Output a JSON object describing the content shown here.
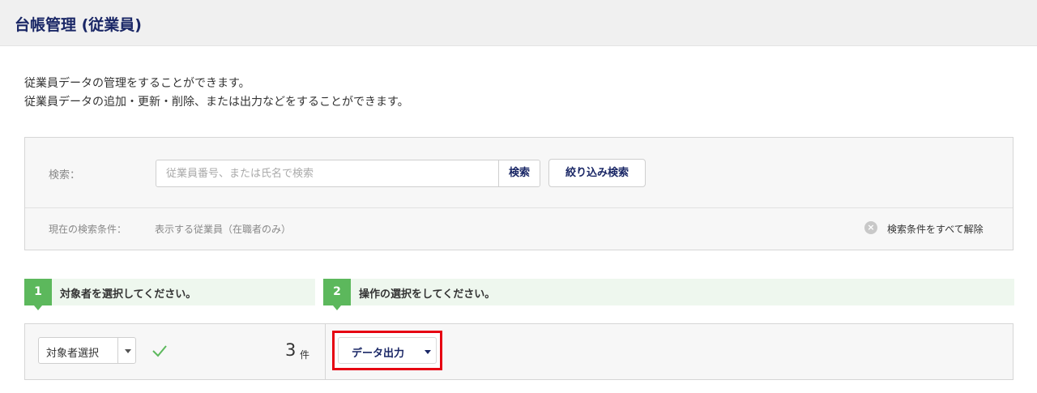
{
  "header": {
    "title": "台帳管理 (従業員)"
  },
  "description": {
    "line1": "従業員データの管理をすることができます。",
    "line2": "従業員データの追加・更新・削除、または出力などをすることができます。"
  },
  "search": {
    "label": "検索：",
    "placeholder": "従業員番号、または氏名で検索",
    "value": "",
    "search_button": "検索",
    "filter_button": "絞り込み検索",
    "condition_label": "現在の検索条件：",
    "condition_value": "表示する従業員（在職者のみ）",
    "clear_label": "検索条件をすべて解除",
    "clear_icon": "close-circle-icon"
  },
  "steps": [
    {
      "number": "1",
      "label": "対象者を選択してください。"
    },
    {
      "number": "2",
      "label": "操作の選択をしてください。"
    }
  ],
  "operation": {
    "select_label": "対象者選択",
    "check_icon": "check-icon",
    "count": "3",
    "count_unit": "件",
    "export_button": "データ出力"
  },
  "colors": {
    "accent_navy": "#1a2766",
    "step_green": "#5cb85c",
    "highlight_red": "#e60012"
  }
}
